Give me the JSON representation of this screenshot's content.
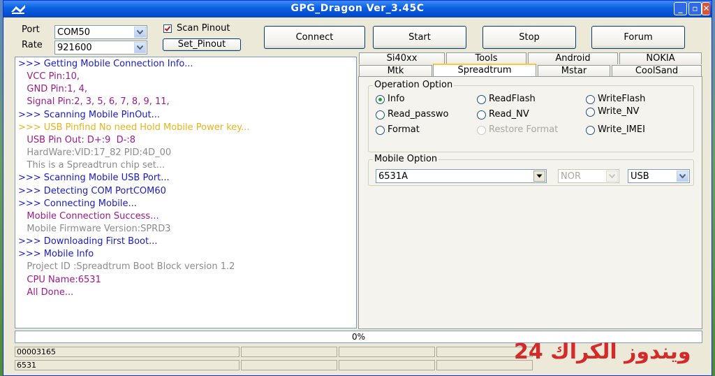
{
  "window": {
    "title": "GPG_Dragon  Ver_3.45C"
  },
  "connection": {
    "port_label": "Port",
    "port_value": "COM50",
    "rate_label": "Rate",
    "rate_value": "921600",
    "scan_pinout_label": "Scan Pinout",
    "scan_pinout_checked": true,
    "set_pinout_label": "Set_Pinout"
  },
  "toolbar": {
    "connect_label": "Connect",
    "start_label": "Start",
    "stop_label": "Stop",
    "forum_label": "Forum"
  },
  "log": [
    {
      "text": ">>> Getting Mobile Connection Info...",
      "color": "#1a1acc"
    },
    {
      "text": "   VCC Pin:10,",
      "color": "#a0198c"
    },
    {
      "text": "   GND Pin:1, 4,",
      "color": "#a0198c"
    },
    {
      "text": "   Signal Pin:2, 3, 5, 6, 7, 8, 9, 11,",
      "color": "#a0198c"
    },
    {
      "text": ">>> Scanning Mobile PinOut...",
      "color": "#1a1acc"
    },
    {
      "text": ">>> USB Pinfind No need Hold Mobile Power key...",
      "color": "#e8b41c"
    },
    {
      "text": "   USB Pin Out: D+:9  D-:8",
      "color": "#a0198c"
    },
    {
      "text": "   HardWare:VID:17_82 PID:4D_00",
      "color": "#8c8c8c"
    },
    {
      "text": "   This is a Spreadtrun chip set...",
      "color": "#8c8c8c"
    },
    {
      "text": ">>> Scanning Mobile USB Port...",
      "color": "#1a1acc"
    },
    {
      "text": ">>> Detecting COM PortCOM60",
      "color": "#1a1acc"
    },
    {
      "text": ">>> Connecting Mobile...",
      "color": "#1a1acc"
    },
    {
      "text": "   Mobile Connection Success...",
      "color": "#a0198c"
    },
    {
      "text": "   Mobile Firmware Version:SPRD3",
      "color": "#8c8c8c"
    },
    {
      "text": ">>> Downloading First Boot...",
      "color": "#1a1acc"
    },
    {
      "text": ">>> Mobile Info",
      "color": "#1a1acc"
    },
    {
      "text": "   Project ID :Spreadtrum Boot Block version 1.2",
      "color": "#8c8c8c"
    },
    {
      "text": "   CPU Name:6531",
      "color": "#a0198c"
    },
    {
      "text": "   All Done...",
      "color": "#a0198c"
    }
  ],
  "tabs": {
    "row1": [
      "Si40xx",
      "Tools",
      "Android",
      "NOKIA"
    ],
    "row2": [
      "Mtk",
      "Spreadtrum",
      "Mstar",
      "CoolSand"
    ],
    "active": "Spreadtrum"
  },
  "operation_option": {
    "title": "Operation Option",
    "options": [
      {
        "label": "Info",
        "checked": true,
        "enabled": true
      },
      {
        "label": "ReadFlash",
        "checked": false,
        "enabled": true
      },
      {
        "label": "WriteFlash",
        "checked": false,
        "enabled": true
      },
      {
        "label": "Read_passwo",
        "checked": false,
        "enabled": true
      },
      {
        "label": "Read_NV",
        "checked": false,
        "enabled": true
      },
      {
        "label": "Write_NV",
        "checked": false,
        "enabled": true
      },
      {
        "label": "Format",
        "checked": false,
        "enabled": true
      },
      {
        "label": "Restore Format",
        "checked": false,
        "enabled": false
      },
      {
        "label": "Write_IMEI",
        "checked": false,
        "enabled": true
      }
    ]
  },
  "mobile_option": {
    "title": "Mobile Option",
    "model_value": "6531A",
    "flash_value": "NOR",
    "interface_value": "USB"
  },
  "progress": {
    "text": "0%",
    "value": 0
  },
  "status": {
    "line1": "00003165",
    "line2": "6531"
  },
  "watermark": {
    "text": "24 ويندوز الكراك"
  }
}
